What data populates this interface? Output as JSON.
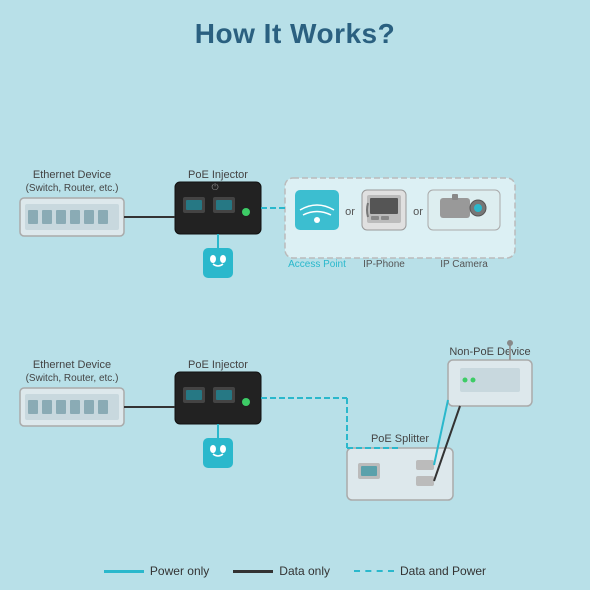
{
  "title": "How It Works?",
  "legend": {
    "power_label": "Power only",
    "data_label": "Data only",
    "data_power_label": "Data and Power"
  },
  "top_section": {
    "ethernet_device_label": "Ethernet Device",
    "ethernet_device_sub": "(Switch, Router, etc.)",
    "poe_injector_label": "PoE Injector",
    "access_point_label": "Access Point",
    "ip_phone_label": "IP-Phone",
    "ip_camera_label": "IP Camera",
    "or1": "or",
    "or2": "or"
  },
  "bottom_section": {
    "ethernet_device_label": "Ethernet Device",
    "ethernet_device_sub": "(Switch, Router, etc.)",
    "poe_injector_label": "PoE Injector",
    "non_poe_device_label": "Non-PoE Device",
    "poe_splitter_label": "PoE Splitter"
  }
}
